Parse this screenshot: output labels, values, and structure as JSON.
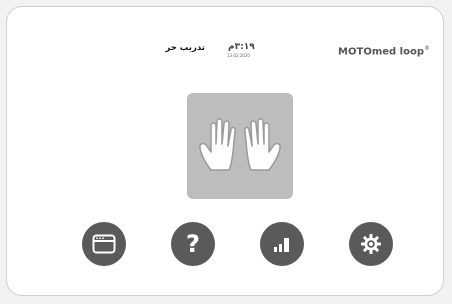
{
  "brand": {
    "name": "MOTOmed loop",
    "registered": "®"
  },
  "status": {
    "time": "٣:١٩م",
    "date": "13.02.2020",
    "mode_title": "تدريب حر"
  },
  "main": {
    "tile_icon": "hands-icon"
  },
  "nav": [
    {
      "icon": "menu-window-icon"
    },
    {
      "icon": "help-icon",
      "glyph": "?"
    },
    {
      "icon": "bar-chart-icon"
    },
    {
      "icon": "gear-icon"
    }
  ],
  "colors": {
    "button": "#5a5a5a",
    "tile": "#bdbdbd",
    "hands": "#ffffff",
    "brand_text": "#555555"
  }
}
